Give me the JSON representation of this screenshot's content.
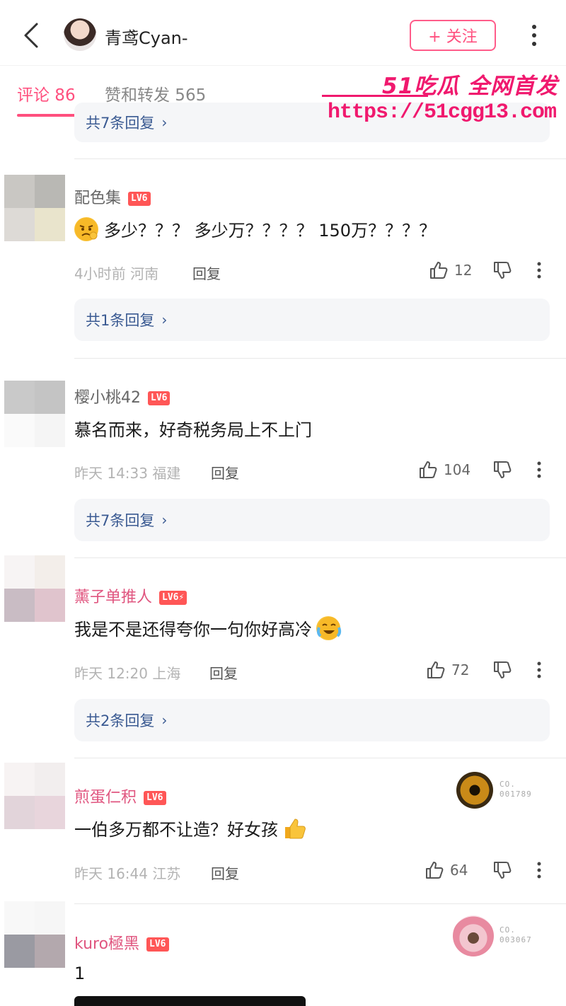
{
  "header": {
    "title": "青鸢Cyan-",
    "follow_label": "+ 关注"
  },
  "tabs": [
    {
      "label": "评论 86",
      "active": true
    },
    {
      "label": "赞和转发 565",
      "active": false
    }
  ],
  "watermark": {
    "line1": "51吃瓜 全网首发",
    "url": "https://51cgg13.com"
  },
  "top_reply_bar": "共7条回复",
  "comments": [
    {
      "name": "配色集",
      "level": "LV6",
      "emoji": "angry-face-icon",
      "text": "多少？？？ 多少万？？？？ 150万？？？？",
      "time": "4小时前",
      "location": "河南",
      "reply_label": "回复",
      "likes": "12",
      "replies": "共1条回复"
    },
    {
      "name": "樱小桃42",
      "level": "LV6",
      "text": "慕名而来，好奇税务局上不上门",
      "time": "昨天 14:33",
      "location": "福建",
      "reply_label": "回复",
      "likes": "104",
      "replies": "共7条回复"
    },
    {
      "name": "薰子单推人",
      "level": "LV6⚡",
      "text": "我是不是还得夸你一句你好高冷",
      "emoji": "crying-laughing-icon",
      "time": "昨天 12:20",
      "location": "上海",
      "reply_label": "回复",
      "likes": "72",
      "replies": "共2条回复"
    },
    {
      "name": "煎蛋仁积",
      "level": "LV6",
      "text": "一伯多万都不让造？好女孩",
      "emoji": "thumbs-up-icon",
      "time": "昨天 16:44",
      "location": "江苏",
      "reply_label": "回复",
      "likes": "64",
      "badge": {
        "line1": "CO.",
        "line2": "001789"
      }
    },
    {
      "name": "kuro極黑",
      "level": "LV6",
      "text": "1",
      "badge": {
        "line1": "CO.",
        "line2": "003067"
      }
    }
  ],
  "colors": {
    "accent": "#ff4f7e",
    "link": "#3a5a92",
    "level_badge": "#ff5656",
    "watermark": "#f0196e"
  }
}
